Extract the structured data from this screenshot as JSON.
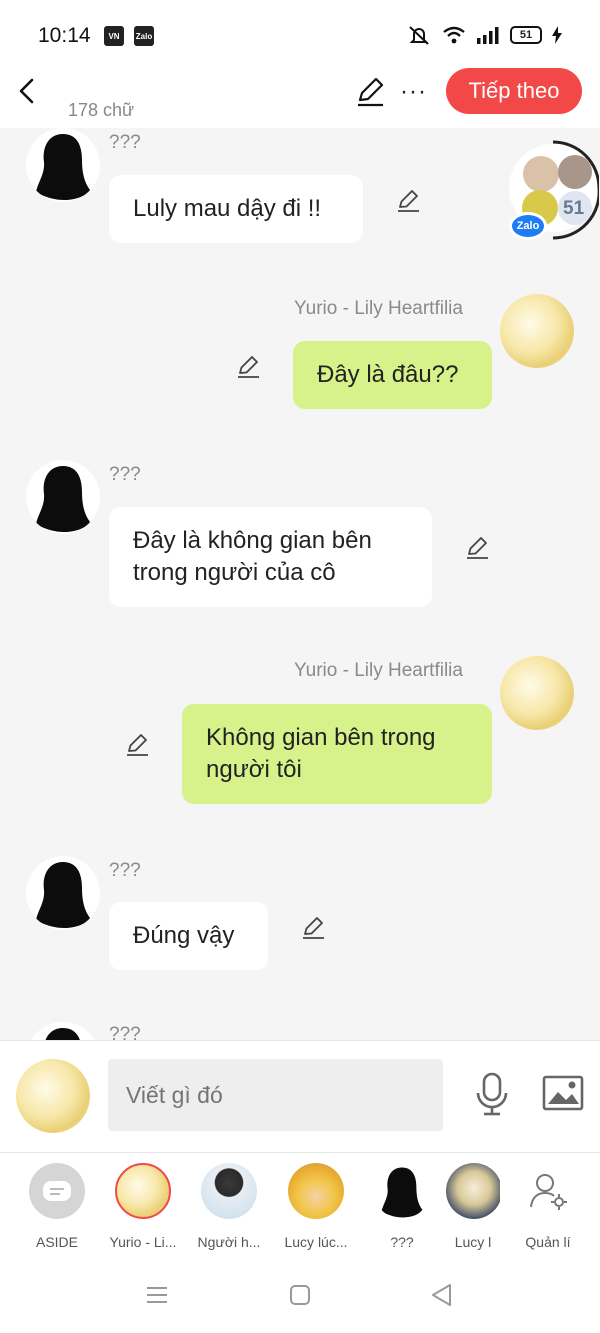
{
  "status_bar": {
    "time": "10:14",
    "battery": "51",
    "app_icons": [
      "VN",
      "Zalo"
    ]
  },
  "header": {
    "char_count": "178 chữ",
    "next_label": "Tiếp theo",
    "accent_color": "#f24848"
  },
  "floating_badge": {
    "count": "51",
    "app": "Zalo"
  },
  "messages": [
    {
      "side": "left",
      "sender": "???",
      "text": "Luly mau dậy đi !!"
    },
    {
      "side": "right",
      "sender": "Yurio - Lily Heartfilia",
      "text": "Đây là đâu??"
    },
    {
      "side": "left",
      "sender": "???",
      "text": "Đây là không gian bên trong người của cô"
    },
    {
      "side": "right",
      "sender": "Yurio - Lily Heartfilia",
      "text": "Không gian bên trong người tôi"
    },
    {
      "side": "left",
      "sender": "???",
      "text": "Đúng vậy"
    },
    {
      "side": "left",
      "sender": "???",
      "text": ""
    }
  ],
  "composer": {
    "placeholder": "Viết gì đó"
  },
  "characters": [
    {
      "name": "ASIDE"
    },
    {
      "name": "Yurio - Li..."
    },
    {
      "name": "Người h..."
    },
    {
      "name": "Lucy lúc..."
    },
    {
      "name": "???"
    },
    {
      "name": "Lucy l"
    },
    {
      "name": "Quản lí"
    }
  ]
}
